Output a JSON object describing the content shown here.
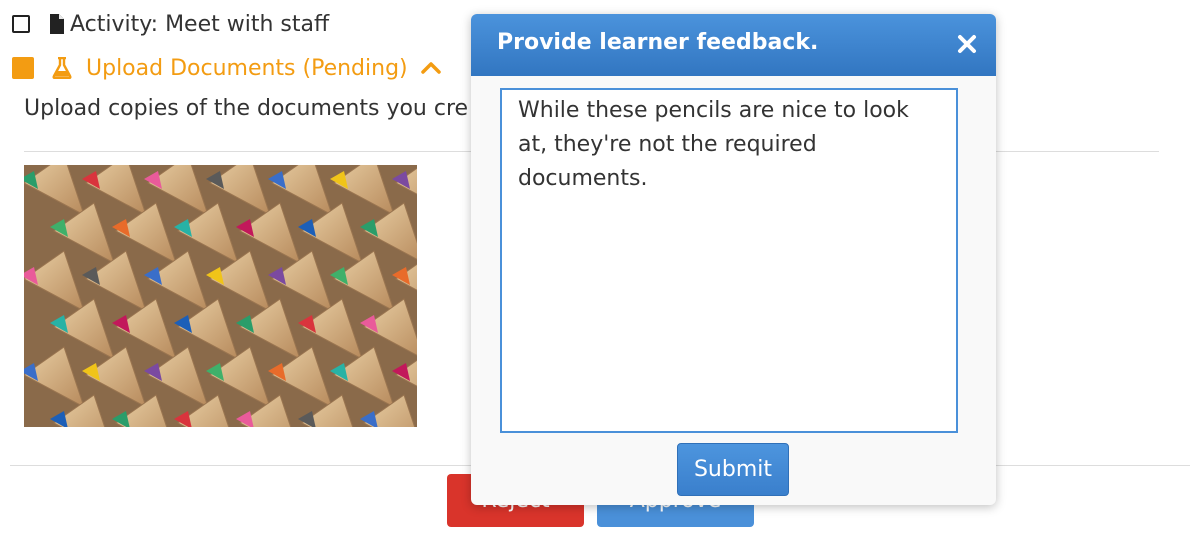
{
  "activities": [
    {
      "label": "Activity: Meet with staff",
      "icon": "document-icon",
      "checked": false
    },
    {
      "label": "Upload Documents (Pending)",
      "icon": "flask-icon",
      "status_color": "#f39c12",
      "expanded": true
    }
  ],
  "task": {
    "description": "Upload copies of the documents you cre"
  },
  "actions": {
    "reject_label": "Reject",
    "approve_label": "Approve"
  },
  "modal": {
    "title": "Provide learner feedback.",
    "feedback_text": "While these pencils are nice to look at, they're not the required documents.",
    "submit_label": "Submit"
  },
  "colors": {
    "accent": "#4a90d9",
    "pending": "#f39c12",
    "danger": "#d9342b"
  }
}
